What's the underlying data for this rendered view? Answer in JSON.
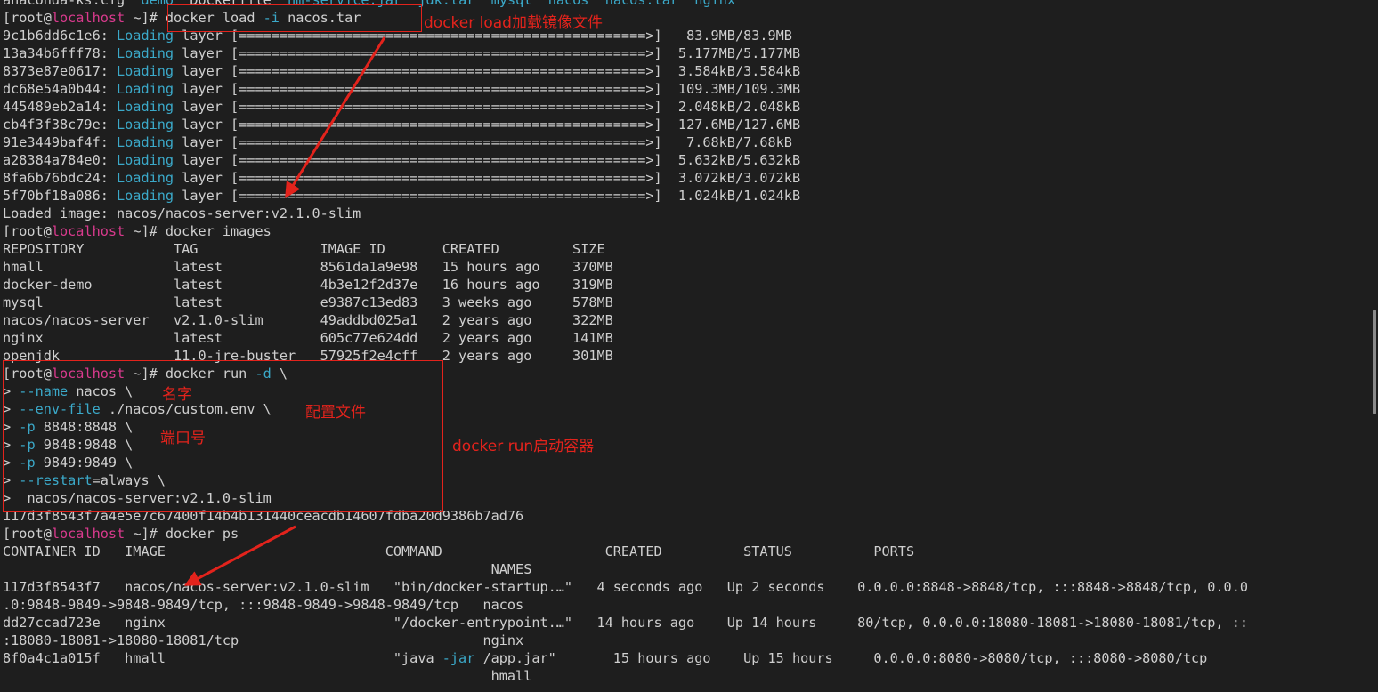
{
  "colors": {
    "background": "#1e1e1e",
    "text": "#cfcfcf",
    "host": "#d93a8d",
    "option": "#3ba9c9",
    "annotation": "#e3231c"
  },
  "prompt": {
    "prefix": "[root@",
    "host": "localhost",
    "suffix": " ~]# "
  },
  "top_partial": {
    "a": "anaconda-ks.cfg  ",
    "demo": "demo",
    "b": "  Dockerfile  ",
    "hm": "hm-service.jar",
    "c": "  ",
    "jdk": "jdk.tar",
    "d": "  ",
    "mysql": "mysql",
    "e": "  ",
    "nacos": "nacos",
    "f": "  ",
    "nacostar": "nacos.tar",
    "g": "  ",
    "nginx": "nginx"
  },
  "load_cmd": {
    "cmd": "docker load ",
    "opt": "-i",
    "arg": " nacos.tar"
  },
  "load_layers": [
    {
      "id": "9c1b6dd6c1e6: ",
      "status": "Loading",
      "bar": " layer [==================================================>]   83.9MB/83.9MB"
    },
    {
      "id": "13a34b6fff78: ",
      "status": "Loading",
      "bar": " layer [==================================================>]  5.177MB/5.177MB"
    },
    {
      "id": "8373e87e0617: ",
      "status": "Loading",
      "bar": " layer [==================================================>]  3.584kB/3.584kB"
    },
    {
      "id": "dc68e54a0b44: ",
      "status": "Loading",
      "bar": " layer [==================================================>]  109.3MB/109.3MB"
    },
    {
      "id": "445489eb2a14: ",
      "status": "Loading",
      "bar": " layer [==================================================>]  2.048kB/2.048kB"
    },
    {
      "id": "cb4f3f38c79e: ",
      "status": "Loading",
      "bar": " layer [==================================================>]  127.6MB/127.6MB"
    },
    {
      "id": "91e3449baf4f: ",
      "status": "Loading",
      "bar": " layer [==================================================>]   7.68kB/7.68kB"
    },
    {
      "id": "a28384a784e0: ",
      "status": "Loading",
      "bar": " layer [==================================================>]  5.632kB/5.632kB"
    },
    {
      "id": "8fa6b76bdc24: ",
      "status": "Loading",
      "bar": " layer [==================================================>]  3.072kB/3.072kB"
    },
    {
      "id": "5f70bf18a086: ",
      "status": "Loading",
      "bar": " layer [==================================================>]  1.024kB/1.024kB"
    }
  ],
  "loaded_msg": "Loaded image: nacos/nacos-server:v2.1.0-slim",
  "images_cmd": "docker images",
  "images_header": "REPOSITORY           TAG               IMAGE ID       CREATED         SIZE",
  "images_rows": [
    "hmall                latest            8561da1a9e98   15 hours ago    370MB",
    "docker-demo          latest            4b3e12f2d37e   16 hours ago    319MB",
    "mysql                latest            e9387c13ed83   3 weeks ago     578MB",
    "nacos/nacos-server   v2.1.0-slim       49addbd025a1   2 years ago     322MB",
    "nginx                latest            605c77e624dd   2 years ago     141MB",
    "openjdk              11.0-jre-buster   57925f2e4cff   2 years ago     301MB"
  ],
  "run": {
    "cmd": "docker run ",
    "d_opt": "-d",
    "cont": " \\",
    "l1_opt": "--name",
    "l1_val": " nacos \\",
    "l2_opt": "--env-file",
    "l2_val": " ./nacos/custom.env \\",
    "l3_opt": "-p",
    "l3_val": " 8848:8848 \\",
    "l4_opt": "-p",
    "l4_val": " 9848:9848 \\",
    "l5_opt": "-p",
    "l5_val": " 9849:9849 \\",
    "l6_opt": "--restart",
    "l6_val": "=always \\",
    "l7_val": " nacos/nacos-server:v2.1.0-slim",
    "cont_prefix": "> "
  },
  "container_hash": "117d3f8543f7a4e5e7c67400f14b4b131440ceacdb14607fdba20d9386b7ad76",
  "ps_cmd": "docker ps",
  "ps_header": "CONTAINER ID   IMAGE                           COMMAND                    CREATED          STATUS          PORTS",
  "ps_names_header": "                                                            NAMES",
  "ps_rows": [
    {
      "l1": "117d3f8543f7   nacos/nacos-server:v2.1.0-slim   \"bin/docker-startup.…\"   4 seconds ago   Up 2 seconds    0.0.0.0:8848->8848/tcp, :::8848->8848/tcp, 0.0.0",
      "l2": ".0:9848-9849->9848-9849/tcp, :::9848-9849->9848-9849/tcp   nacos"
    },
    {
      "l1": "dd27ccad723e   nginx                            \"/docker-entrypoint.…\"   14 hours ago    Up 14 hours     80/tcp, 0.0.0.0:18080-18081->18080-18081/tcp, ::",
      "l2": ":18080-18081->18080-18081/tcp                              nginx"
    },
    {
      "l1": "8f0a4c1a015f   hmall                            \"java ",
      "l1_opt": "-jar",
      "l1_rest": " /app.jar\"       15 hours ago    Up 15 hours     0.0.0.0:8080->8080/tcp, :::8080->8080/tcp",
      "l2": "                                                            hmall"
    }
  ],
  "annotations": {
    "load": "docker load加载镜像文件",
    "name": "名字",
    "config": "配置文件",
    "port": "端口号",
    "run": "docker run启动容器"
  }
}
